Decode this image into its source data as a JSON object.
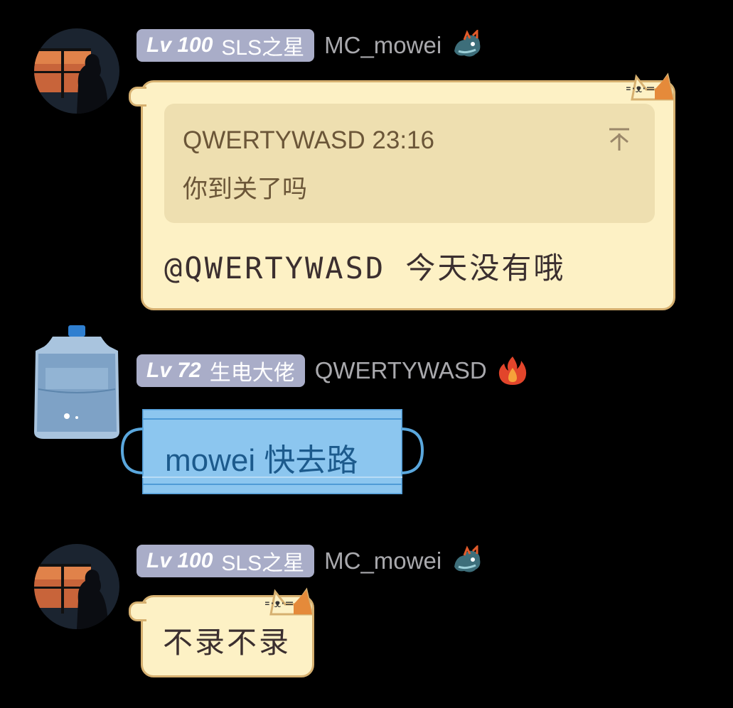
{
  "messages": [
    {
      "badge": {
        "level": "Lv 100",
        "title": "SLS之星"
      },
      "username": "MC_mowei",
      "name_icon": "dragon-icon",
      "quote": {
        "header": "QWERTYWASD 23:16",
        "text": "你到关了吗",
        "icon": "scroll-to-top-icon"
      },
      "text": "@QWERTYWASD 今天没有哦"
    },
    {
      "badge": {
        "level": "Lv 72",
        "title": "生电大佬"
      },
      "username": "QWERTYWASD",
      "name_icon": "fire-icon",
      "text": "mowei 快去路"
    },
    {
      "badge": {
        "level": "Lv 100",
        "title": "SLS之星"
      },
      "username": "MC_mowei",
      "name_icon": "dragon-icon",
      "text": "不录不录"
    }
  ],
  "colors": {
    "background": "#000000",
    "badge": "#a9adc8",
    "cat_bubble": "#fdf1c5",
    "cat_border": "#d6b070",
    "mask_blue": "#8cc6ef"
  }
}
